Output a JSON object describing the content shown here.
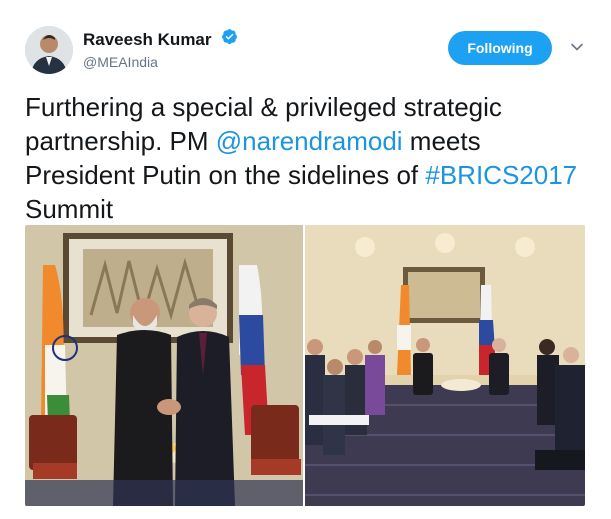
{
  "author": {
    "display_name": "Raveesh Kumar",
    "handle": "@MEAIndia",
    "verified": true,
    "avatar_icon": "profile-photo"
  },
  "actions": {
    "follow_label": "Following",
    "menu_icon": "chevron-down-icon"
  },
  "tweet": {
    "text_part1": "Furthering a special & privileged strategic partnership. PM ",
    "mention": "@narendramodi",
    "text_part2": " meets President Putin on the sidelines of ",
    "hashtag": "#BRICS2017",
    "text_part3": " Summit"
  },
  "media": {
    "photos": [
      "photo-handshake",
      "photo-delegation-meeting"
    ]
  },
  "colors": {
    "accent": "#1da1f2",
    "link": "#1b95e0",
    "text": "#14171a",
    "secondary": "#657786"
  }
}
